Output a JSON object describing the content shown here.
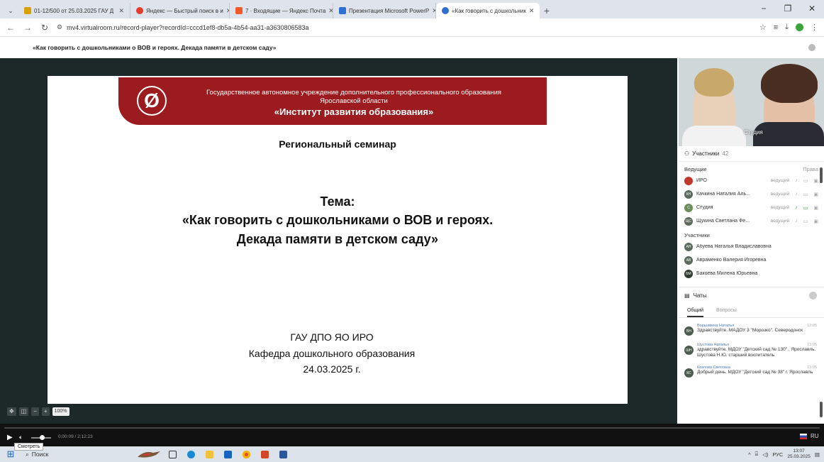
{
  "browser": {
    "tabs": [
      {
        "label": "01-12/500 от 25.03.2025 ГАУ Д",
        "color": "#d9a100"
      },
      {
        "label": "Яндекс — Быстрый поиск в и",
        "color": "#e43b2d"
      },
      {
        "label": "7 · Входящие — Яндекс Почта",
        "color": "#f05a28"
      },
      {
        "label": "Презентация Microsoft PowerP",
        "color": "#2e6fd1"
      },
      {
        "label": "«Как говорить с дошкольник",
        "color": "#2e6fd1",
        "active": true
      }
    ],
    "new_tab": "+",
    "url": "mv4.virtualroom.ru/record-player?recordId=cccd1ef8-db5a-4b54-aa31-a3630806583a",
    "window_controls": {
      "minimize": "−",
      "maximize": "❐",
      "close": "✕"
    }
  },
  "page": {
    "title": "«Как говорить с дошкольниками о ВОВ и героях. Декада памяти в детском саду»"
  },
  "slide": {
    "banner_line1": "Государственное автономное учреждение дополнительного профессионального образования",
    "banner_line2": "Ярославской области",
    "banner_line3": "«Институт развития образования»",
    "seminar": "Региональный семинар",
    "theme_label": "Тема:",
    "theme_line1": "«Как говорить с дошкольниками о ВОВ и героях.",
    "theme_line2": "Декада памяти в детском саду»",
    "org_line1": "ГАУ ДПО ЯО ИРО",
    "org_line2": "Кафедра дошкольного образования",
    "org_line3": "24.03.2025 г."
  },
  "zoom": {
    "minus": "−",
    "plus": "+",
    "value": "100%"
  },
  "video": {
    "label": "Студия"
  },
  "participants": {
    "title": "Участники",
    "count": "42",
    "hosts_label": "Ведущие",
    "rights_label": "Права",
    "hosts": [
      {
        "initials": "",
        "name": "ИРО",
        "role": "ведущий"
      },
      {
        "initials": "КН",
        "name": "Качкина Наталия Аль...",
        "role": "ведущий"
      },
      {
        "initials": "С",
        "name": "Студия",
        "role": "ведущий"
      },
      {
        "initials": "ЩС",
        "name": "Щукина Светлана Фе...",
        "role": "ведущий"
      }
    ],
    "members_label": "Участники",
    "members": [
      {
        "initials": "АН",
        "name": "Абуева Наталья Владиславовна"
      },
      {
        "initials": "АВ",
        "name": "Авраменко Валерия Игоревна"
      },
      {
        "initials": "БМ",
        "name": "Бакоева Милена Юрьевна"
      }
    ]
  },
  "chat": {
    "title": "Чаты",
    "tabs": [
      "Общий",
      "Вопросы"
    ],
    "messages": [
      {
        "initials": "ВН",
        "author": "Воршавина Наталья",
        "time": "13:05",
        "text": "Здравствуйте. МАДОУ 3 \"Морозко\". Северодонск"
      },
      {
        "initials": "ШН",
        "author": "Шустова Наталья",
        "time": "13:05",
        "text": "здравствуйте. МДОУ \"Детский сад № 130\" , Ярославль. Шустова Н.Ю. старший воспитатель"
      },
      {
        "initials": "КС",
        "author": "Козлова Светлана",
        "time": "13:05",
        "text": "Добрый день. МДОУ \"Детский сад № 38\" г. Ярославль"
      }
    ]
  },
  "player": {
    "time": "0:00:09 / 2:12:23",
    "tooltip": "Смотреть",
    "lang": "RU"
  },
  "taskbar": {
    "search": "Поиск",
    "tray_lang": "РУС",
    "time": "13:07",
    "date": "25.03.2025"
  }
}
